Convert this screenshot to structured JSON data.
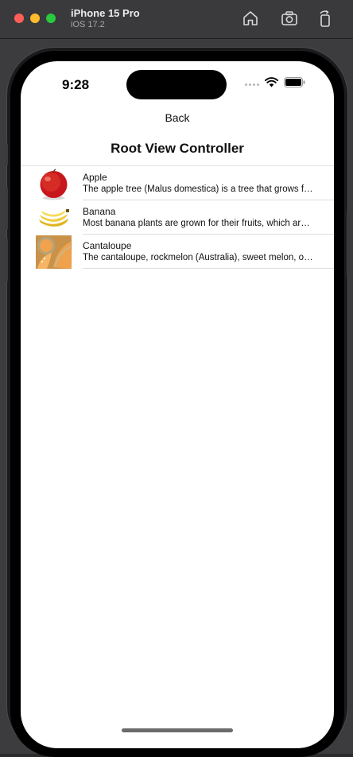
{
  "window": {
    "device_name": "iPhone 15 Pro",
    "os_version": "iOS 17.2",
    "toolbar_icons": [
      "home-icon",
      "screenshot-icon",
      "rotate-icon"
    ]
  },
  "status_bar": {
    "time": "9:28",
    "icons": [
      "cellular-icon",
      "wifi-icon",
      "battery-icon"
    ]
  },
  "nav": {
    "back_label": "Back",
    "title": "Root View Controller"
  },
  "items": [
    {
      "title": "Apple",
      "subtitle": "The apple tree (Malus domestica) is a tree that grows fruit (such as apples) in the rose family"
    },
    {
      "title": "Banana",
      "subtitle": "Most banana plants are grown for their fruits, which are eaten raw or cooked"
    },
    {
      "title": "Cantaloupe",
      "subtitle": "The cantaloupe, rockmelon (Australia), sweet melon, or spanspek (South Africa)"
    }
  ],
  "colors": {
    "close": "#ff5f57",
    "minimize": "#febc2e",
    "zoom": "#28c840"
  }
}
